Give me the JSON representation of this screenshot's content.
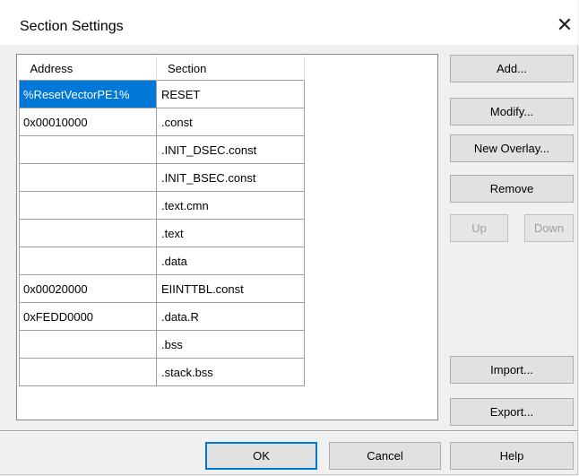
{
  "dialog": {
    "title": "Section Settings",
    "close_glyph": "✕"
  },
  "table": {
    "columns": [
      "Address",
      "Section"
    ],
    "rows": [
      {
        "address": "%ResetVectorPE1%",
        "section": "RESET",
        "selected": true
      },
      {
        "address": "0x00010000",
        "section": ".const"
      },
      {
        "address": "",
        "section": ".INIT_DSEC.const"
      },
      {
        "address": "",
        "section": ".INIT_BSEC.const"
      },
      {
        "address": "",
        "section": ".text.cmn"
      },
      {
        "address": "",
        "section": ".text"
      },
      {
        "address": "",
        "section": ".data"
      },
      {
        "address": "0x00020000",
        "section": "EIINTTBL.const"
      },
      {
        "address": "0xFEDD0000",
        "section": ".data.R"
      },
      {
        "address": "",
        "section": ".bss"
      },
      {
        "address": "",
        "section": ".stack.bss"
      }
    ]
  },
  "side_buttons": {
    "add": "Add...",
    "modify": "Modify...",
    "new_overlay": "New Overlay...",
    "remove": "Remove",
    "up": "Up",
    "down": "Down",
    "import": "Import...",
    "export": "Export..."
  },
  "footer": {
    "ok": "OK",
    "cancel": "Cancel",
    "help": "Help"
  },
  "colors": {
    "selection": "#0078d7",
    "default_button_border": "#0078d7"
  }
}
